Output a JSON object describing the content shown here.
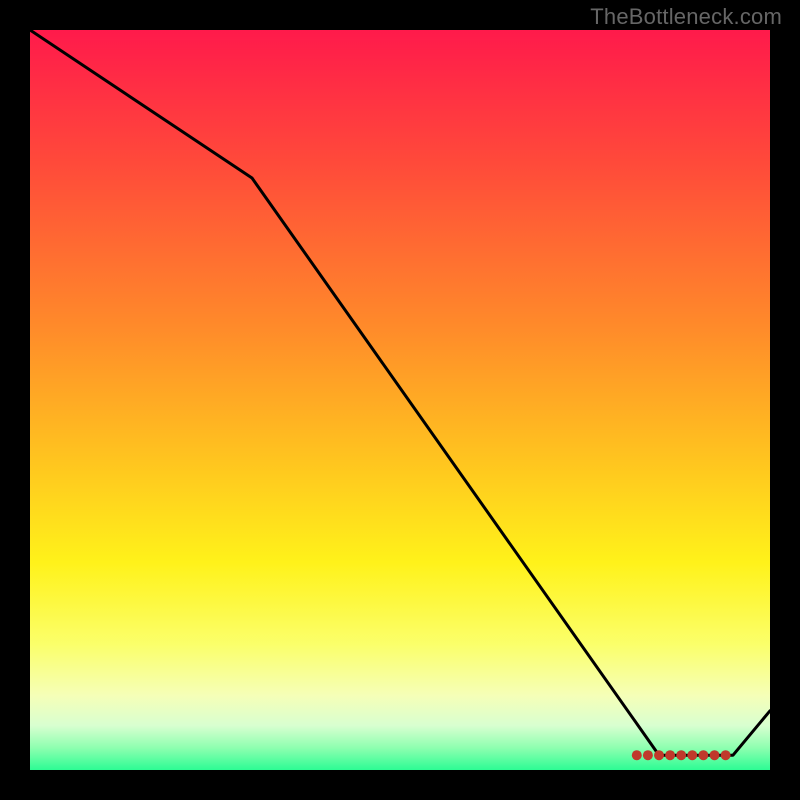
{
  "watermark": "TheBottleneck.com",
  "chart_data": {
    "type": "line",
    "title": "",
    "xlabel": "",
    "ylabel": "",
    "xlim": [
      0,
      100
    ],
    "ylim": [
      0,
      100
    ],
    "series": [
      {
        "name": "curve",
        "x": [
          0,
          30,
          85,
          95,
          100
        ],
        "values": [
          100,
          80,
          2,
          2,
          8
        ]
      }
    ],
    "markers": {
      "x_start": 82,
      "x_end": 94,
      "y": 2,
      "count": 9
    },
    "background_gradient": {
      "stops": [
        {
          "pos": 0.0,
          "color": "#ff1a4b"
        },
        {
          "pos": 0.18,
          "color": "#ff4a3a"
        },
        {
          "pos": 0.4,
          "color": "#ff8a2a"
        },
        {
          "pos": 0.58,
          "color": "#ffc41f"
        },
        {
          "pos": 0.72,
          "color": "#fff21a"
        },
        {
          "pos": 0.83,
          "color": "#fbff6a"
        },
        {
          "pos": 0.9,
          "color": "#f5ffb8"
        },
        {
          "pos": 0.94,
          "color": "#d8ffd0"
        },
        {
          "pos": 0.97,
          "color": "#8effb0"
        },
        {
          "pos": 1.0,
          "color": "#2dfc94"
        }
      ]
    }
  }
}
